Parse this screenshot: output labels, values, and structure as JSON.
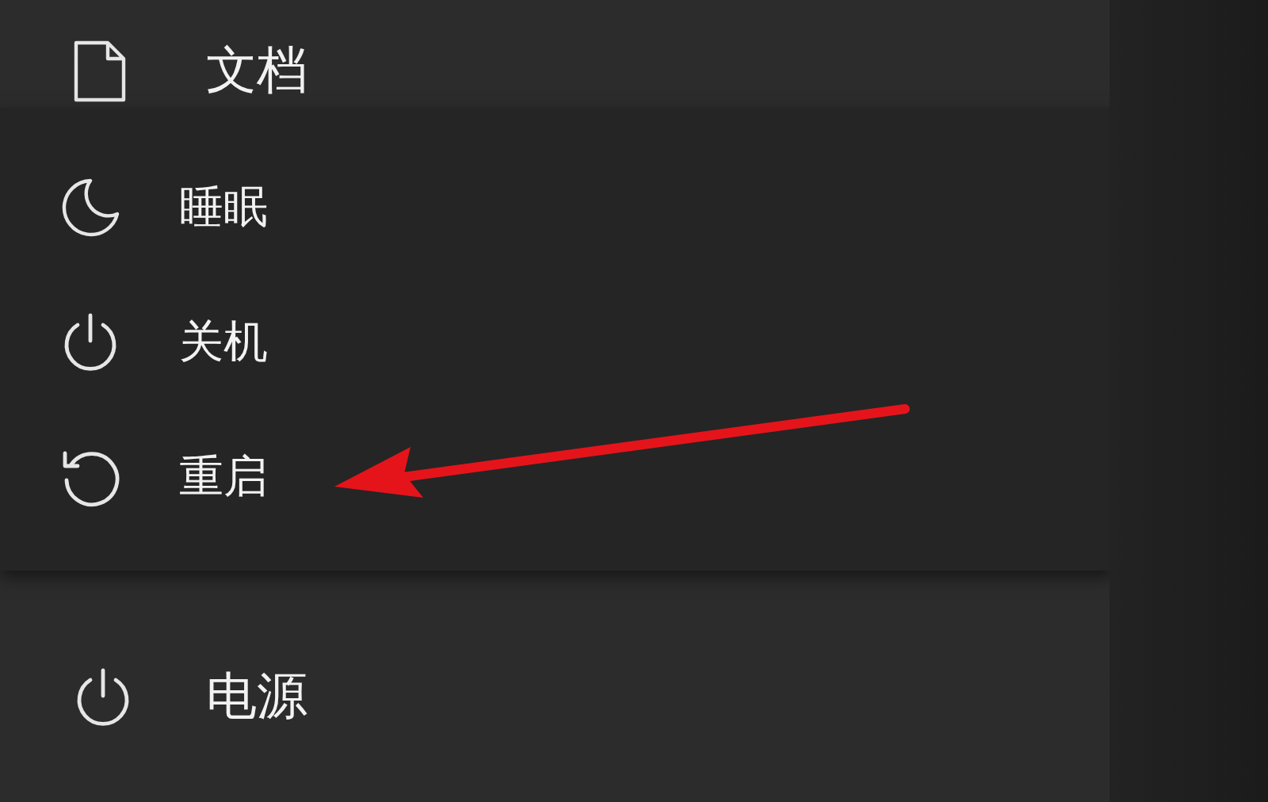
{
  "top_item": {
    "label": "文档"
  },
  "power_menu": {
    "items": [
      {
        "kind": "sleep",
        "label": "睡眠"
      },
      {
        "kind": "shutdown",
        "label": "关机"
      },
      {
        "kind": "restart",
        "label": "重启"
      }
    ]
  },
  "bottom_item": {
    "label": "电源"
  }
}
